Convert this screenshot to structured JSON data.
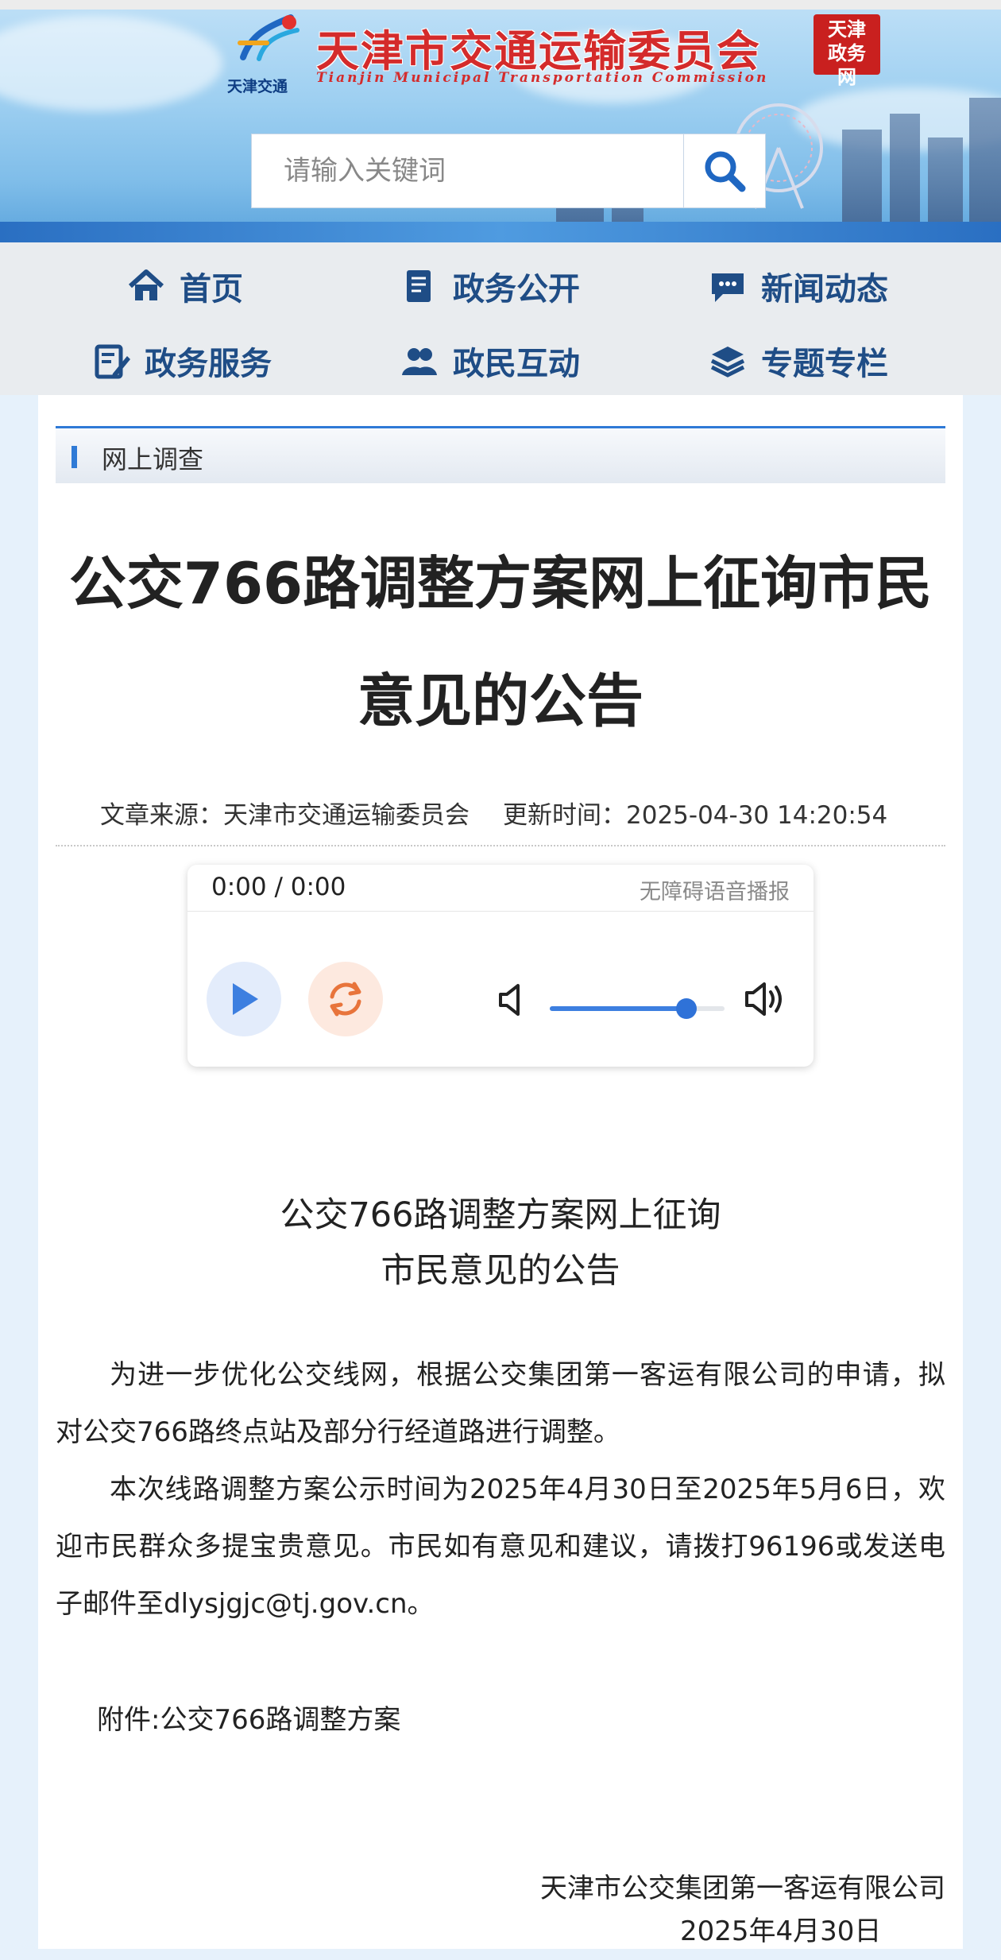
{
  "header": {
    "logo_text": "天津交通",
    "site_title": "天津市交通运输委员会",
    "site_subtitle": "Tianjin Municipal Transportation Commission",
    "seal_text": "天津政务网",
    "search": {
      "placeholder": "请输入关键词"
    }
  },
  "nav": {
    "items": [
      {
        "label": "首页",
        "icon": "home-icon"
      },
      {
        "label": "政务公开",
        "icon": "document-icon"
      },
      {
        "label": "新闻动态",
        "icon": "chat-icon"
      },
      {
        "label": "政务服务",
        "icon": "edit-icon"
      },
      {
        "label": "政民互动",
        "icon": "users-icon"
      },
      {
        "label": "专题专栏",
        "icon": "layers-icon"
      }
    ]
  },
  "breadcrumb": {
    "label": "网上调查"
  },
  "article": {
    "headline": "公交766路调整方案网上征询市民意见的公告",
    "source": "文章来源：天津市交通运输委员会",
    "updated": "更新时间：2025-04-30 14:20:54",
    "subtitle_line1": "公交766路调整方案网上征询",
    "subtitle_line2": "市民意见的公告",
    "para1": "为进一步优化公交线网，根据公交集团第一客运有限公司的申请，拟对公交766路终点站及部分行经道路进行调整。",
    "para2": "本次线路调整方案公示时间为2025年4月30日至2025年5月6日，欢迎市民群众多提宝贵意见。市民如有意见和建议，请拨打96196或发送电子邮件至dlysjgjc@tj.gov.cn。",
    "attachment": "附件:公交766路调整方案",
    "signature_org": "天津市公交集团第一客运有限公司",
    "signature_date": "2025年4月30日"
  },
  "player": {
    "time": "0:00 / 0:00",
    "accessibility_label": "无障碍语音播报",
    "volume": 0.78,
    "colors": {
      "play_bg": "#e3ecfb",
      "play_icon": "#3d7fe0",
      "loop_bg": "#fde9df",
      "loop_icon": "#e8743b"
    }
  },
  "colors": {
    "title_red": "#d42b2b",
    "nav_blue": "#1f4d86",
    "accent_blue": "#2f7ad6",
    "page_bg": "#e6f1fb"
  }
}
